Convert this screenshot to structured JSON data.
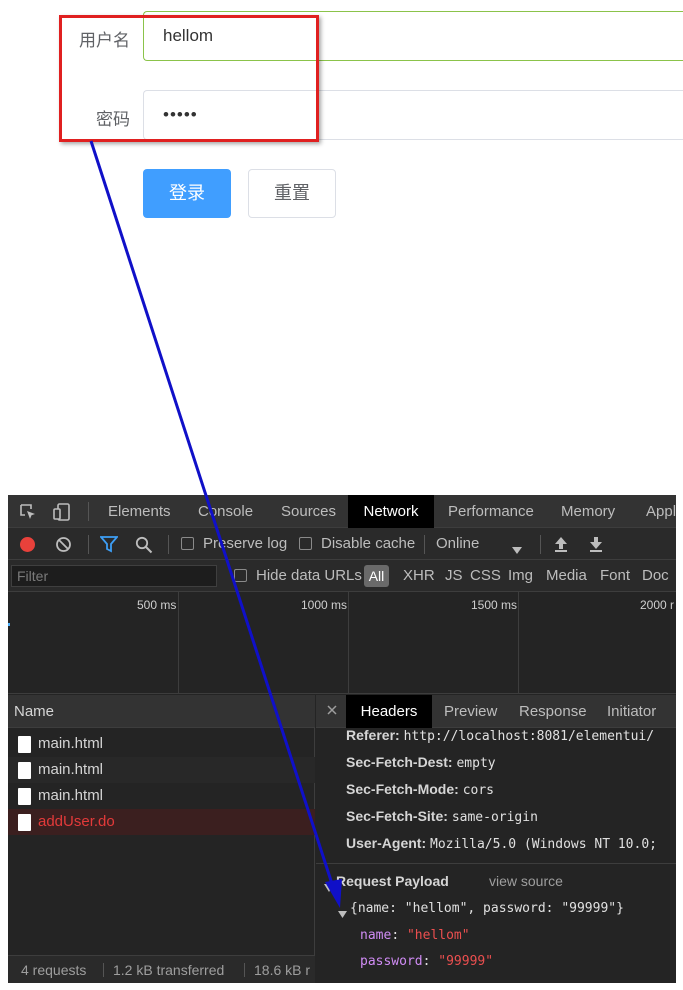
{
  "form": {
    "username_label": "用户名",
    "username_value": "hellom",
    "password_label": "密码",
    "password_value": "•••••",
    "login_label": "登录",
    "reset_label": "重置"
  },
  "devtools": {
    "tabs": [
      "Elements",
      "Console",
      "Sources",
      "Network",
      "Performance",
      "Memory",
      "Appl"
    ],
    "toolbar": {
      "preserve_log": "Preserve log",
      "disable_cache": "Disable cache",
      "throttle": "Online"
    },
    "filter": {
      "placeholder": "Filter",
      "hide_data_urls": "Hide data URLs",
      "types": [
        "All",
        "XHR",
        "JS",
        "CSS",
        "Img",
        "Media",
        "Font",
        "Doc"
      ]
    },
    "timeline_labels": [
      "500 ms",
      "1000 ms",
      "1500 ms",
      "2000 r"
    ],
    "name_header": "Name",
    "requests": [
      "main.html",
      "main.html",
      "main.html",
      "addUser.do"
    ],
    "status": {
      "requests": "4 requests",
      "transferred": "1.2 kB transferred",
      "resources": "18.6 kB r"
    },
    "detail_tabs": [
      "Headers",
      "Preview",
      "Response",
      "Initiator"
    ],
    "headers": [
      {
        "key": "Referer:",
        "value": "http://localhost:8081/elementui/"
      },
      {
        "key": "Sec-Fetch-Dest:",
        "value": "empty"
      },
      {
        "key": "Sec-Fetch-Mode:",
        "value": "cors"
      },
      {
        "key": "Sec-Fetch-Site:",
        "value": "same-origin"
      },
      {
        "key": "User-Agent:",
        "value": "Mozilla/5.0 (Windows NT 10.0;"
      }
    ],
    "payload": {
      "title": "Request Payload",
      "view_source": "view source",
      "summary": "{name: \"hellom\", password: \"99999\"}",
      "fields": [
        {
          "key": "name",
          "value": "\"hellom\""
        },
        {
          "key": "password",
          "value": "\"99999\""
        }
      ]
    }
  },
  "colors": {
    "highlight": "#e02020",
    "arrow": "#1010c8",
    "primary_button": "#409eff",
    "error_row": "#e33a3a"
  }
}
